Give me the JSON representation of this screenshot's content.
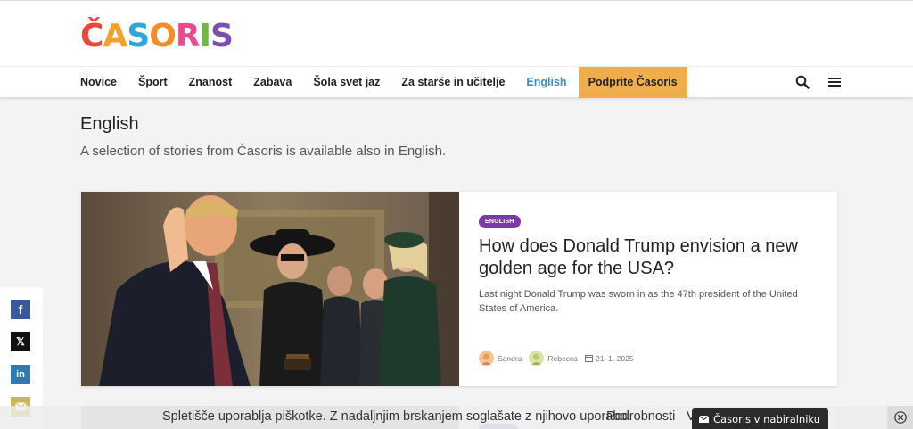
{
  "logo": {
    "letters": [
      "Č",
      "A",
      "S",
      "O",
      "R",
      "I",
      "S"
    ],
    "colors": [
      "#e8473a",
      "#f2a22c",
      "#2fa5d8",
      "#f28c28",
      "#e64b8b",
      "#6cbb3c",
      "#7b4fb0"
    ]
  },
  "nav": {
    "items": [
      "Novice",
      "Šport",
      "Znanost",
      "Zabava",
      "Šola svet jaz",
      "Za starše in učitelje",
      "English"
    ],
    "cta": "Podprite Časoris",
    "search_icon": "search-icon",
    "menu_icon": "hamburger-icon",
    "active_color": "#3a8fc6",
    "cta_color": "#f0ad4e"
  },
  "page": {
    "title": "English",
    "subtitle": "A selection of stories from Časoris is available also in English."
  },
  "article": {
    "category": "ENGLISH",
    "headline": "How does Donald Trump envision a new golden age for the USA?",
    "excerpt": "Last night Donald Trump was sworn in as the 47th president of the United States of America.",
    "authors": [
      "Sandra",
      "Rebecca"
    ],
    "date": "21. 1. 2025",
    "badge_color": "#7b3aa3"
  },
  "share": {
    "facebook": "f",
    "x": "𝕏",
    "linkedin": "in",
    "email_icon": "envelope-icon"
  },
  "cookie": {
    "text": "Spletišče uporablja piškotke. Z nadaljnjim brskanjem soglašate z njihovo uporabo.",
    "details": "Podrobnosti",
    "trailing": "V",
    "newsletter": "Časoris v nabiralniku",
    "close_icon": "close-circle-icon"
  }
}
